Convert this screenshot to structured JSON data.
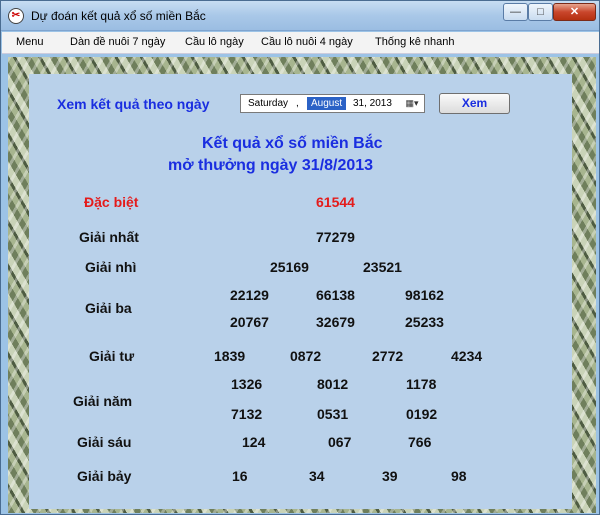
{
  "window": {
    "title": "Dự đoán kết quả xổ số miền Bắc",
    "icon": "lottery-app-icon",
    "controls": {
      "minimize": "—",
      "maximize": "□",
      "close": "✕"
    }
  },
  "menu": [
    "Menu",
    "Dàn đề nuôi 7 ngày",
    "Cầu lô ngày",
    "Cầu lô nuôi  4 ngày",
    "Thống kê nhanh"
  ],
  "viewer": {
    "label": "Xem kết quả theo ngày",
    "date": {
      "weekday": "Saturday",
      "separator": ",",
      "month": "August",
      "rest": "31, 2013",
      "dropdown_icon": "calendar-dropdown-icon"
    },
    "button_label": "Xem"
  },
  "result": {
    "heading_line1": "Kết quả xổ số miền Bắc",
    "heading_line2": "mở thưởng ngày 31/8/2013",
    "colors": {
      "special": "#e41b1b",
      "heading": "#1a2ee0"
    },
    "prizes": {
      "special": {
        "label": "Đặc biệt",
        "numbers": [
          "61544"
        ]
      },
      "first": {
        "label": "Giải nhất",
        "numbers": [
          "77279"
        ]
      },
      "second": {
        "label": "Giải nhì",
        "numbers": [
          "25169",
          "23521"
        ]
      },
      "third": {
        "label": "Giải ba",
        "numbers": [
          "22129",
          "66138",
          "98162",
          "20767",
          "32679",
          "25233"
        ]
      },
      "fourth": {
        "label": "Giải tư",
        "numbers": [
          "1839",
          "0872",
          "2772",
          "4234"
        ]
      },
      "fifth": {
        "label": "Giải năm",
        "numbers": [
          "1326",
          "8012",
          "1178",
          "7132",
          "0531",
          "0192"
        ]
      },
      "sixth": {
        "label": "Giải sáu",
        "numbers": [
          "124",
          "067",
          "766"
        ]
      },
      "seventh": {
        "label": "Giải bảy",
        "numbers": [
          "16",
          "34",
          "39",
          "98"
        ]
      }
    }
  }
}
